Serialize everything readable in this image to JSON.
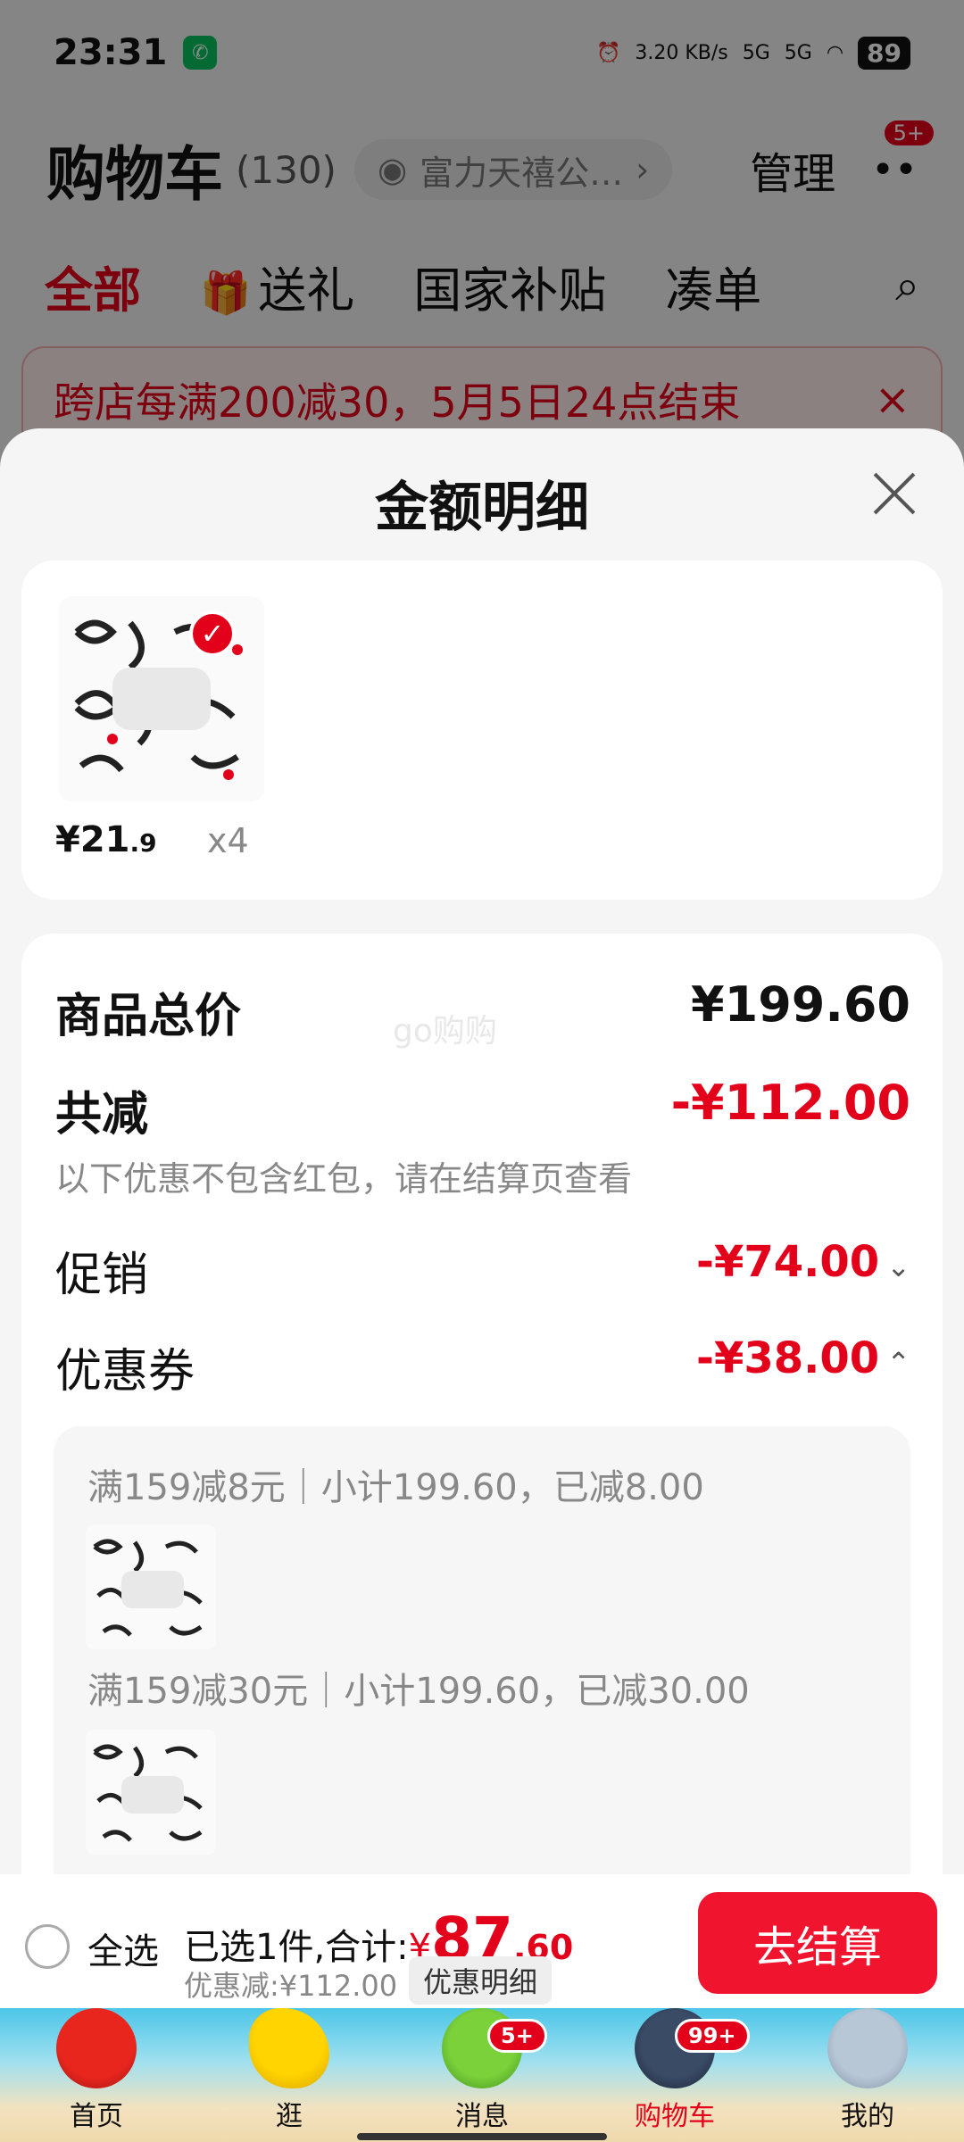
{
  "status_bar": {
    "time": "23:31",
    "network_speed": "3.20 KB/s",
    "signal1": "5G",
    "signal2": "5G",
    "battery": "89"
  },
  "cart_header": {
    "title": "购物车",
    "count": "(130)",
    "shop_name": "富力天禧公…",
    "manage_label": "管理",
    "more_badge": "5+"
  },
  "tabs": [
    {
      "label": "全部"
    },
    {
      "label": "送礼"
    },
    {
      "label": "国家补贴"
    },
    {
      "label": "凑单"
    }
  ],
  "promo_banner": {
    "text": "跨店每满200减30，5月5日24点结束"
  },
  "sheet": {
    "title": "金额明细",
    "product": {
      "price_main": "¥21",
      "price_decimal": ".9",
      "quantity": "x4"
    },
    "summary": {
      "total_label": "商品总价",
      "total_value": "¥199.60",
      "reduce_label": "共减",
      "reduce_value": "-¥112.00",
      "reduce_hint": "以下优惠不包含红包，请在结算页查看",
      "promo_label": "促销",
      "promo_value": "-¥74.00",
      "coupon_label": "优惠券",
      "coupon_value": "-¥38.00"
    },
    "coupons": [
      {
        "text": "满159减8元｜小计199.60，已减8.00"
      },
      {
        "text": "满159减30元｜小计199.60，已减30.00"
      }
    ]
  },
  "watermark": "go购购",
  "checkout": {
    "select_all": "全选",
    "selected_prefix": "已选1件,合计:",
    "currency": "¥",
    "total_main": "87",
    "total_decimal": ".60",
    "discount_text": "优惠减:¥112.00",
    "detail_label": "优惠明细",
    "checkout_label": "去结算"
  },
  "bottom_nav": [
    {
      "label": "首页",
      "badge": ""
    },
    {
      "label": "逛",
      "badge": ""
    },
    {
      "label": "消息",
      "badge": "5+"
    },
    {
      "label": "购物车",
      "badge": "99+"
    },
    {
      "label": "我的",
      "badge": ""
    }
  ],
  "colors": {
    "accent_red": "#e3001b",
    "checkout_red": "#f0142f"
  }
}
